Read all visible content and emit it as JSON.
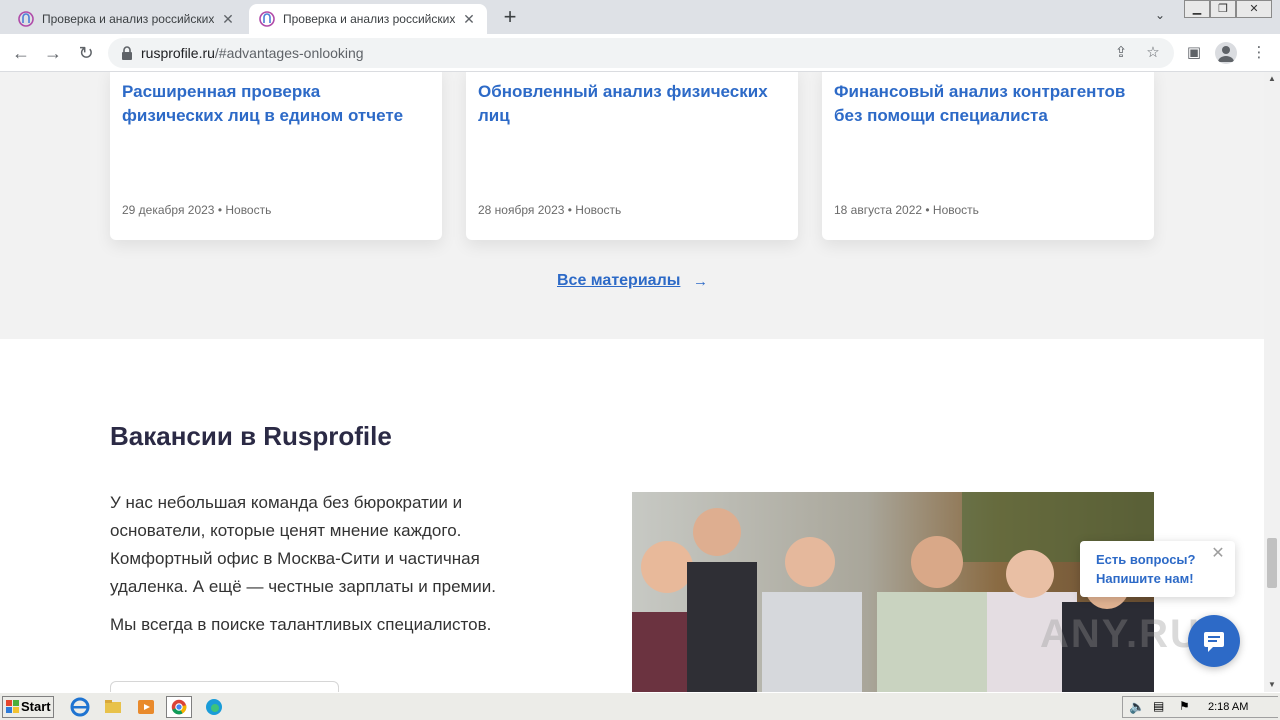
{
  "browser": {
    "tabs": [
      {
        "title": "Проверка и анализ российских юр",
        "active": false
      },
      {
        "title": "Проверка и анализ российских юр",
        "active": true
      }
    ],
    "new_tab": "+",
    "url_host": "rusprofile.ru",
    "url_path": "/#advantages-onlooking"
  },
  "news": {
    "cards": [
      {
        "title": "Расширенная проверка физических лиц в едином отчете",
        "meta": "29 декабря 2023 • Новость"
      },
      {
        "title": "Обновленный анализ физических лиц",
        "meta": "28 ноября 2023 • Новость"
      },
      {
        "title": "Финансовый анализ контрагентов без помощи специалиста",
        "meta": "18 августа 2022 • Новость"
      }
    ],
    "all_link": "Все материалы",
    "all_arrow": "→"
  },
  "vacancies": {
    "title": "Вакансии в Rusprofile",
    "text": "У нас небольшая команда без бюрократии и основатели, которые ценят мнение каждого. Комфортный офис в Москва-Сити и частичная удаленка. А ещё — честные зарплаты и премии.",
    "text2": "Мы всегда в поиске талантливых специалистов."
  },
  "chat": {
    "line1": "Есть вопросы?",
    "line2": "Напишите нам!"
  },
  "watermark": "ANY.RUN",
  "taskbar": {
    "start_label": "Start",
    "clock": "2:18 AM"
  },
  "colors": {
    "accent": "#2d6ac7",
    "heading": "#2b2a45"
  }
}
